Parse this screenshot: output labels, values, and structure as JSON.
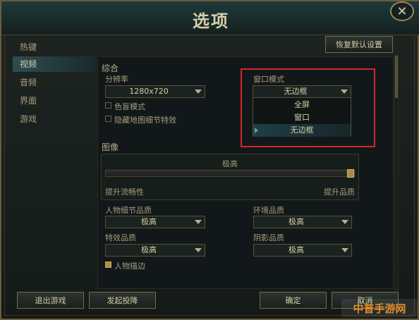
{
  "window": {
    "title": "选项"
  },
  "sidebar": {
    "items": [
      {
        "label": "热键"
      },
      {
        "label": "视频"
      },
      {
        "label": "音频"
      },
      {
        "label": "界面"
      },
      {
        "label": "游戏"
      }
    ]
  },
  "header": {
    "reset_label": "恢复默认设置"
  },
  "general": {
    "section_title": "综合",
    "resolution_label": "分辨率",
    "resolution_value": "1280x720",
    "colorblind_label": "色盲模式",
    "hide_map_label": "隐藏地图细节特效"
  },
  "window_mode": {
    "label": "窗口模式",
    "value": "无边框",
    "options": [
      "全屏",
      "窗口",
      "无边框"
    ]
  },
  "graphics": {
    "section_title": "图像",
    "level_label": "极高",
    "slider_value_percent": 100,
    "left_hint": "提升流畅性",
    "right_hint": "提升品质"
  },
  "quality": {
    "character_label": "人物细节品质",
    "character_value": "极高",
    "environment_label": "环境品质",
    "environment_value": "极高",
    "effects_label": "特效品质",
    "effects_value": "极高",
    "shadow_label": "阴影品质",
    "shadow_value": "极高",
    "outline_label": "人物描边"
  },
  "footer": {
    "exit_label": "退出游戏",
    "surrender_label": "发起投降",
    "ok_label": "确定",
    "cancel_label": "取消"
  },
  "watermark": {
    "text": "中普手游网"
  },
  "colors": {
    "accent_gold": "#7a6a44",
    "highlight_red": "#d02828",
    "active_teal": "#2e4c52"
  }
}
